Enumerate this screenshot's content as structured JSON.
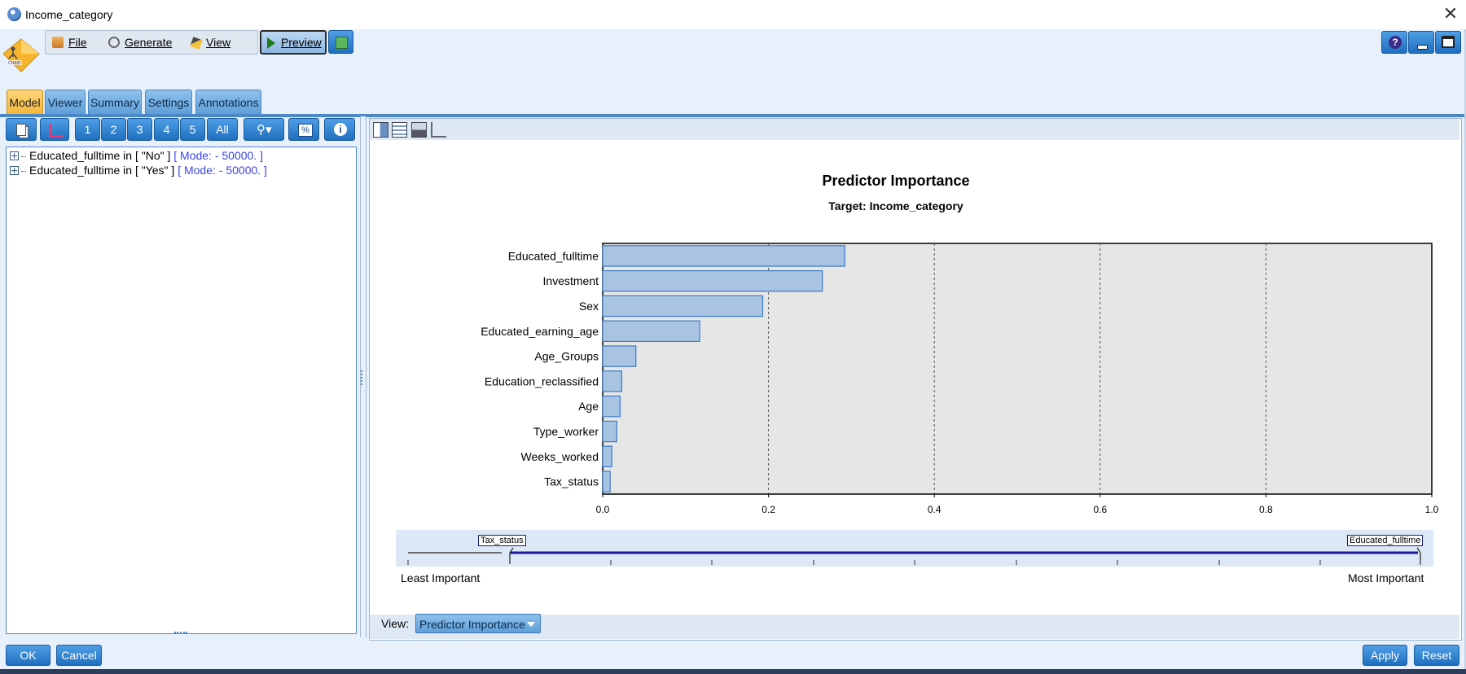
{
  "window": {
    "title": "Income_category",
    "close_glyph": "✕"
  },
  "menu": {
    "file": {
      "label": "File",
      "icon": "file-folder-icon"
    },
    "generate": {
      "label": "Generate",
      "icon": "generate-icon"
    },
    "view": {
      "label": "View",
      "icon": "view-brush-icon"
    },
    "preview": {
      "label": "Preview",
      "icon": "play-icon"
    }
  },
  "tabs": [
    {
      "label": "Model",
      "active": true
    },
    {
      "label": "Viewer",
      "active": false
    },
    {
      "label": "Summary",
      "active": false
    },
    {
      "label": "Settings",
      "active": false
    },
    {
      "label": "Annotations",
      "active": false
    }
  ],
  "tree_toolbar": {
    "level_buttons": [
      "1",
      "2",
      "3",
      "4",
      "5",
      "All"
    ],
    "percent_label": "%",
    "info_label": "i"
  },
  "tree": [
    {
      "text": "Educated_fulltime in [ \"No\" ]",
      "mode": "[ Mode:  - 50000. ]"
    },
    {
      "text": "Educated_fulltime in [ \"Yes\" ]",
      "mode": "[ Mode:  - 50000. ]"
    }
  ],
  "chart_data": {
    "type": "bar",
    "orientation": "horizontal",
    "title": "Predictor Importance",
    "subtitle": "Target: Income_category",
    "categories": [
      "Educated_fulltime",
      "Investment",
      "Sex",
      "Educated_earning_age",
      "Age_Groups",
      "Education_reclassified",
      "Age",
      "Type_worker",
      "Weeks_worked",
      "Tax_status"
    ],
    "values": [
      0.292,
      0.265,
      0.193,
      0.117,
      0.04,
      0.023,
      0.021,
      0.017,
      0.011,
      0.009
    ],
    "xlim": [
      0.0,
      1.0
    ],
    "xticks": [
      "0.0",
      "0.2",
      "0.4",
      "0.6",
      "0.8",
      "1.0"
    ],
    "grid": "vertical dashed",
    "bar_color": "#a9c4e2",
    "bar_border": "#3b7ac4",
    "plot_background": "#e6e6e6"
  },
  "scale": {
    "least_label": "Least Important",
    "most_label": "Most Important",
    "left_marker": "Tax_status",
    "right_marker": "Educated_fulltime"
  },
  "view_bar": {
    "label": "View:",
    "selected": "Predictor Importance"
  },
  "footer": {
    "ok": "OK",
    "cancel": "Cancel",
    "apply": "Apply",
    "reset": "Reset"
  },
  "colors": {
    "accent": "#2f7fd0",
    "tab_active": "#f5b73c",
    "background": "#e8f1fb"
  }
}
